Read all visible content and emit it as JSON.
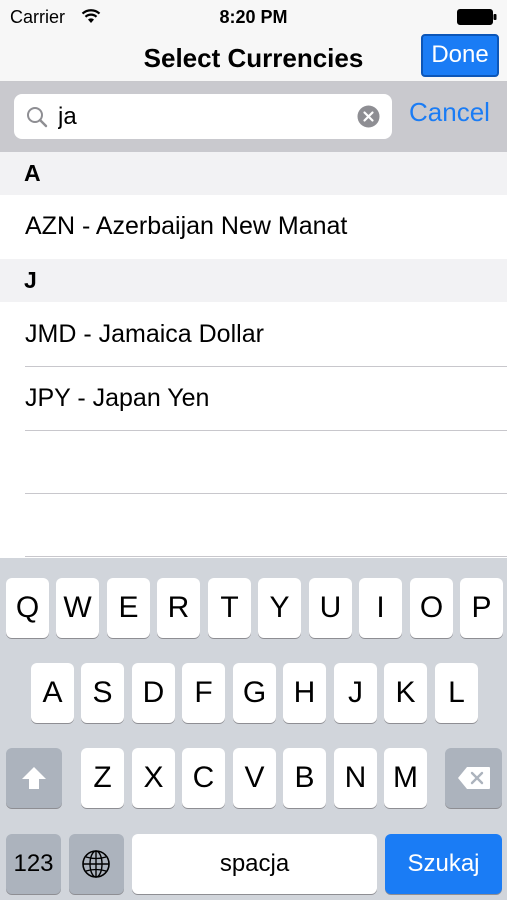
{
  "status_bar": {
    "carrier": "Carrier",
    "time": "8:20 PM"
  },
  "nav": {
    "title": "Select Currencies",
    "done_label": "Done"
  },
  "search": {
    "value": "ja",
    "cancel_label": "Cancel"
  },
  "sections": [
    {
      "header": "A",
      "rows": [
        "AZN - Azerbaijan New Manat"
      ]
    },
    {
      "header": "J",
      "rows": [
        "JMD - Jamaica Dollar",
        "JPY - Japan Yen"
      ]
    }
  ],
  "keyboard": {
    "row1": [
      "Q",
      "W",
      "E",
      "R",
      "T",
      "Y",
      "U",
      "I",
      "O",
      "P"
    ],
    "row2": [
      "A",
      "S",
      "D",
      "F",
      "G",
      "H",
      "J",
      "K",
      "L"
    ],
    "row3": [
      "Z",
      "X",
      "C",
      "V",
      "B",
      "N",
      "M"
    ],
    "numbers_label": "123",
    "space_label": "spacja",
    "search_label": "Szukaj"
  },
  "colors": {
    "accent": "#1a7cf5",
    "keyboard_bg": "#d1d5db",
    "search_bar_bg": "#c9c9ce"
  },
  "icons": {
    "wifi": "wifi-icon",
    "battery": "battery-icon",
    "search": "search-icon",
    "clear": "clear-icon",
    "shift": "shift-icon",
    "delete": "delete-icon",
    "globe": "globe-icon"
  }
}
